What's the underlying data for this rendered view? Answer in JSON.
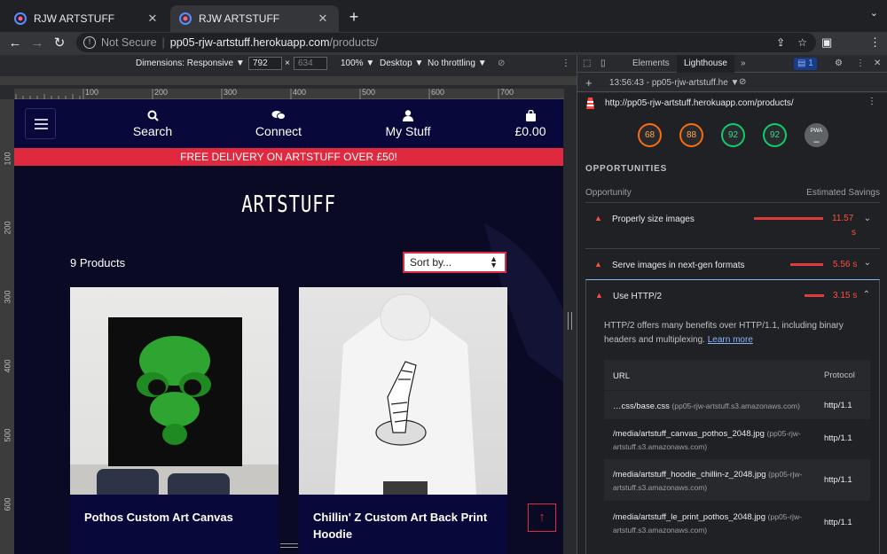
{
  "browser": {
    "tabs": [
      {
        "title": "RJW ARTSTUFF",
        "close": "✕"
      },
      {
        "title": "RJW ARTSTUFF",
        "close": "✕"
      }
    ],
    "new_tab": "+",
    "tab_menu": "⌄",
    "security": "Not Secure",
    "url_host": "pp05-rjw-artstuff.herokuapp.com",
    "url_path": "/products/"
  },
  "device_toolbar": {
    "dimensions": "Dimensions: Responsive ▼",
    "width": "792",
    "times": "×",
    "height": "634",
    "zoom": "100% ▼",
    "mode": "Desktop ▼",
    "throttle": "No throttling ▼"
  },
  "ruler": {
    "h_ticks": [
      "100",
      "200",
      "300",
      "400",
      "500",
      "600",
      "700"
    ],
    "v_ticks": [
      "100",
      "200",
      "300",
      "400",
      "500",
      "600"
    ]
  },
  "site": {
    "nav": [
      {
        "label": "Search",
        "icon": "search-icon"
      },
      {
        "label": "Connect",
        "icon": "chat-icon"
      },
      {
        "label": "My Stuff",
        "icon": "user-icon"
      },
      {
        "label": "£0.00",
        "icon": "bag-icon"
      }
    ],
    "banner": "FREE DELIVERY ON ARTSTUFF OVER £50!",
    "logo": "ARTSTUFF",
    "product_count": "9 Products",
    "sort_label": "Sort by...",
    "products": [
      {
        "name": "Pothos Custom Art Canvas"
      },
      {
        "name": "Chillin' Z Custom Art Back Print Hoodie"
      }
    ],
    "scroll_top": "↑"
  },
  "devtools": {
    "tabs": [
      "Elements",
      "Lighthouse"
    ],
    "more": "»",
    "issues_count": "1",
    "report_time": "13:56:43 - pp05-rjw-artstuff.he ▼",
    "report_url": "http://pp05-rjw-artstuff.herokuapp.com/products/",
    "scores": [
      "68",
      "88",
      "92",
      "92"
    ],
    "pwa_label": "PWA",
    "opportunities_title": "OPPORTUNITIES",
    "col_opportunity": "Opportunity",
    "col_savings": "Estimated Savings",
    "audits": [
      {
        "title": "Properly size images",
        "savings": "11.57",
        "unit": "s"
      },
      {
        "title": "Serve images in next-gen formats",
        "savings": "5.56 s"
      },
      {
        "title": "Use HTTP/2",
        "savings": "3.15 s"
      }
    ],
    "http2_desc": "HTTP/2 offers many benefits over HTTP/1.1, including binary headers and multiplexing.",
    "learn_more": "Learn more",
    "table_headers": {
      "url": "URL",
      "protocol": "Protocol"
    },
    "rows": [
      {
        "path": "…css/base.css",
        "host": "(pp05-rjw-artstuff.s3.amazonaws.com)",
        "protocol": "http/1.1"
      },
      {
        "path": "/media/artstuff_canvas_pothos_2048.jpg",
        "host": "(pp05-rjw-artstuff.s3.amazonaws.com)",
        "protocol": "http/1.1"
      },
      {
        "path": "/media/artstuff_hoodie_chillin-z_2048.jpg",
        "host": "(pp05-rjw-artstuff.s3.amazonaws.com)",
        "protocol": "http/1.1"
      },
      {
        "path": "/media/artstuff_le_print_pothos_2048.jpg",
        "host": "(pp05-rjw-artstuff.s3.amazonaws.com)",
        "protocol": "http/1.1"
      }
    ]
  }
}
